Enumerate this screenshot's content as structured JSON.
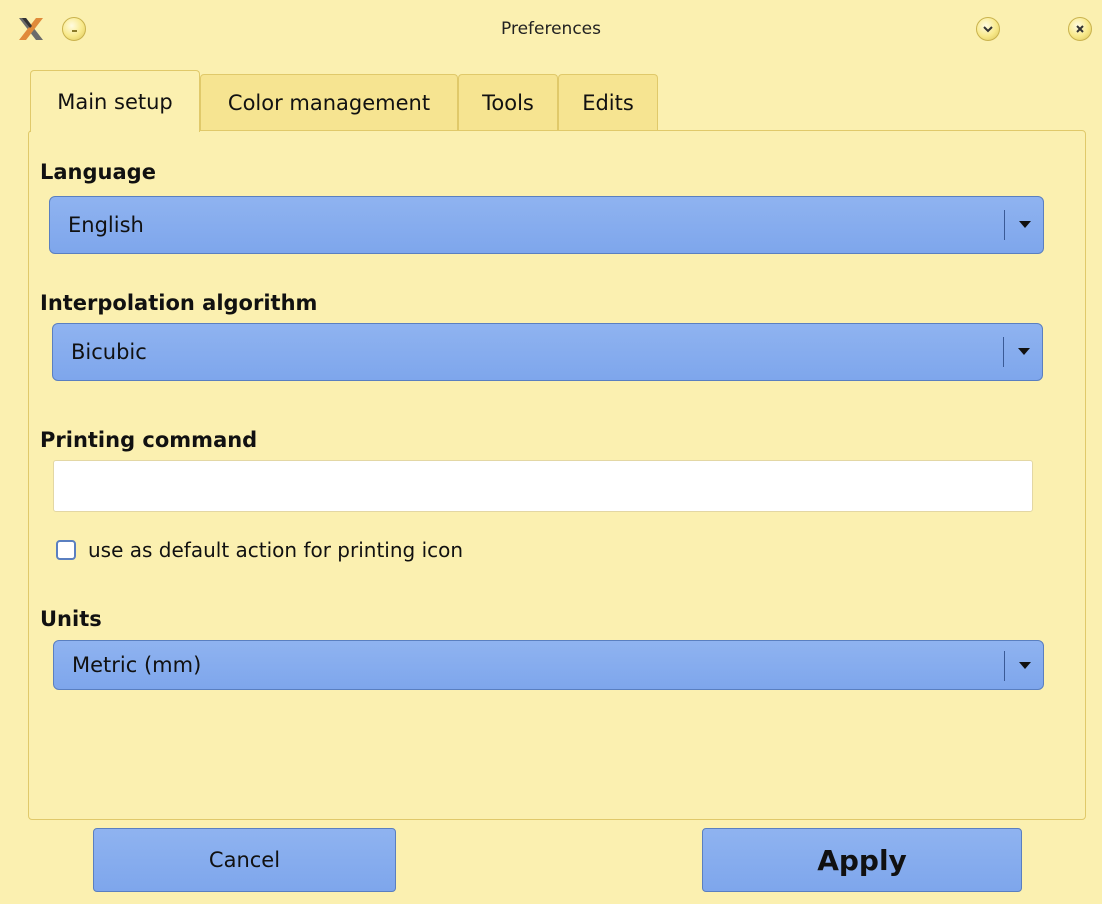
{
  "window": {
    "title": "Preferences",
    "icons": {
      "app": "x-logo-icon",
      "minimize": "minimize-icon",
      "shade": "chevron-down-icon",
      "close": "close-icon"
    }
  },
  "tabs": [
    {
      "label": "Main setup",
      "active": true
    },
    {
      "label": "Color management",
      "active": false
    },
    {
      "label": "Tools",
      "active": false
    },
    {
      "label": "Edits",
      "active": false
    }
  ],
  "main_setup": {
    "language": {
      "label": "Language",
      "value": "English"
    },
    "interpolation": {
      "label": "Interpolation algorithm",
      "value": "Bicubic"
    },
    "printing": {
      "label": "Printing command",
      "value": "",
      "default_action_label": "use as default action for printing icon",
      "default_action_checked": false
    },
    "units": {
      "label": "Units",
      "value": "Metric (mm)"
    }
  },
  "buttons": {
    "cancel": "Cancel",
    "apply": "Apply"
  },
  "colors": {
    "background": "#fbf0b0",
    "accent": "#8fb3f0",
    "border": "#e0c96a"
  }
}
